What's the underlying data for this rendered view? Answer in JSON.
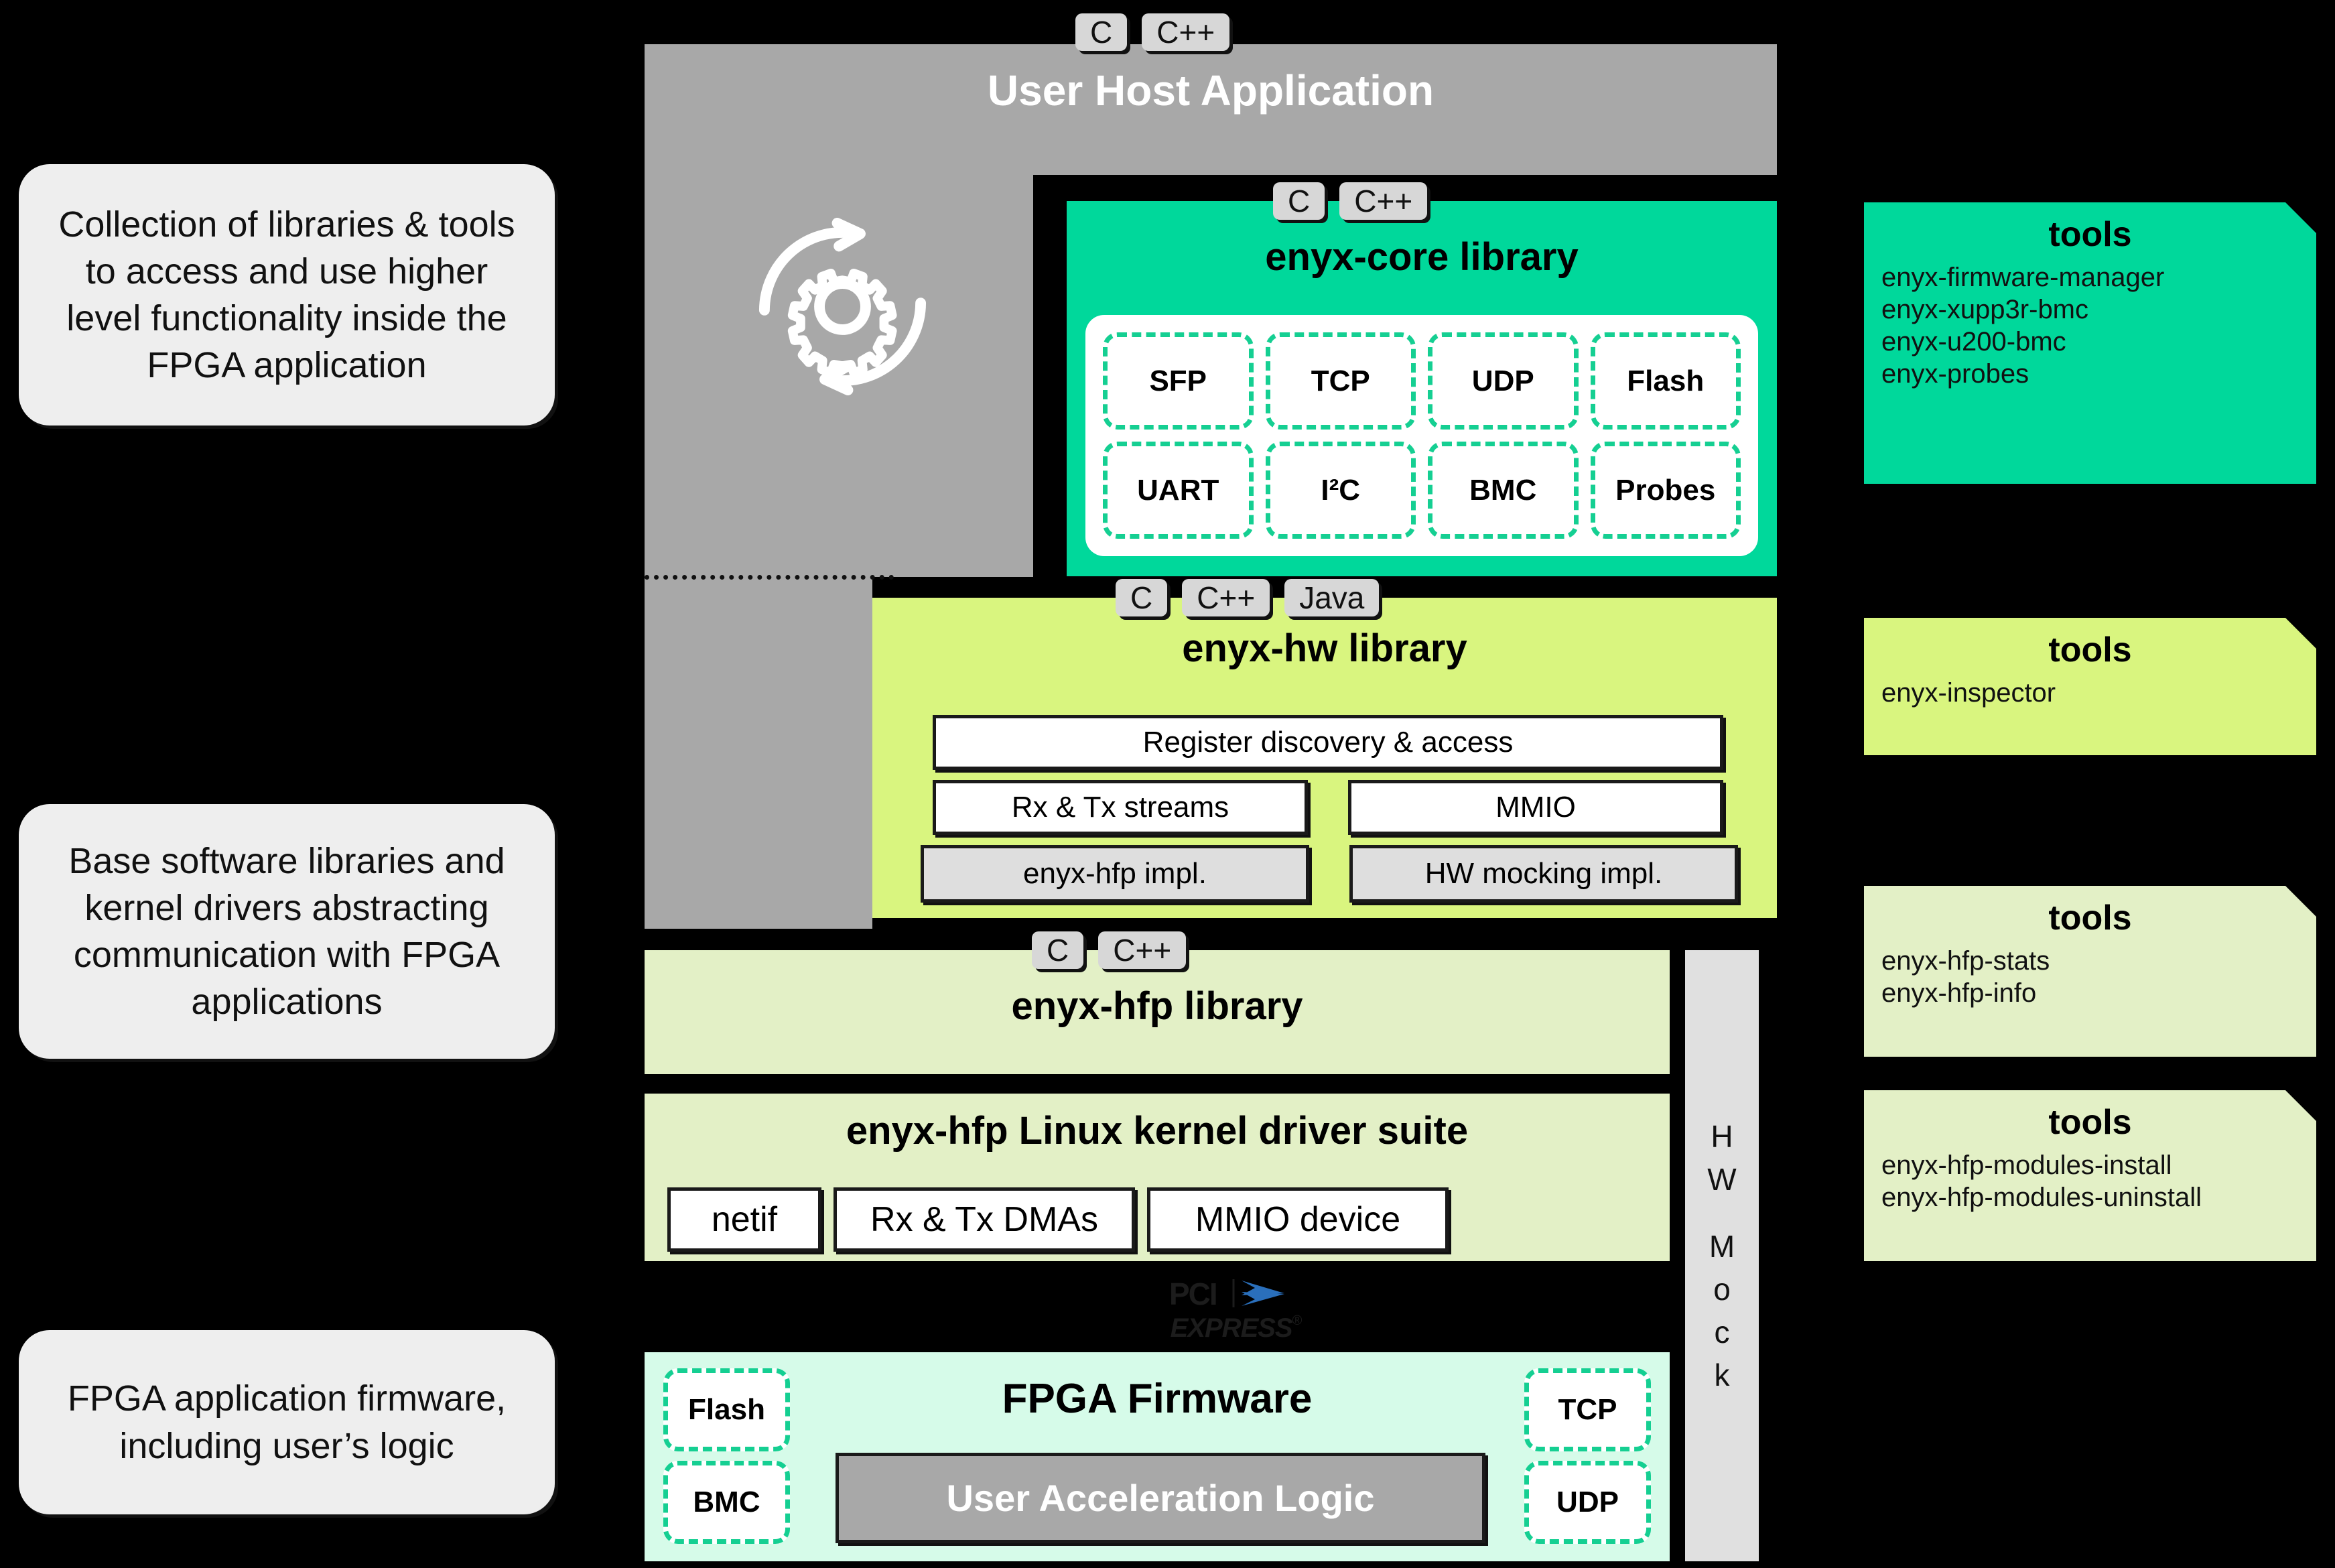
{
  "callouts": [
    {
      "text": "Collection of libraries & tools to access and use higher level functionality inside the FPGA application"
    },
    {
      "text": "Base software libraries and kernel drivers abstracting communication with FPGA applications"
    },
    {
      "text": "FPGA application firmware, including user’s logic"
    }
  ],
  "host": {
    "title": "User Host Application",
    "langs": [
      "C",
      "C++"
    ],
    "icon": "gear-sync-icon"
  },
  "core": {
    "title": "enyx-core library",
    "langs": [
      "C",
      "C++"
    ],
    "modules": [
      "SFP",
      "TCP",
      "UDP",
      "Flash",
      "UART",
      "I²C",
      "BMC",
      "Probes"
    ]
  },
  "hw": {
    "title": "enyx-hw library",
    "langs": [
      "C",
      "C++",
      "Java"
    ],
    "wide_item": "Register discovery & access",
    "row2": [
      "Rx & Tx streams",
      "MMIO"
    ],
    "row3": [
      "enyx-hfp impl.",
      "HW mocking impl."
    ]
  },
  "hfp_lib": {
    "title": "enyx-hfp library",
    "langs": [
      "C",
      "C++"
    ]
  },
  "kernel": {
    "title": "enyx-hfp Linux kernel driver suite",
    "items": [
      "netif",
      "Rx & Tx DMAs",
      "MMIO device"
    ]
  },
  "pcie": {
    "line1": "PCI",
    "line2": "EXPRESS",
    "mark": "®"
  },
  "firmware": {
    "title": "FPGA Firmware",
    "left_chips": [
      "Flash",
      "BMC"
    ],
    "right_chips": [
      "TCP",
      "UDP"
    ],
    "center": "User Acceleration Logic"
  },
  "hw_mock": {
    "letters": [
      "H",
      "W",
      "",
      "M",
      "o",
      "c",
      "k"
    ],
    "label": "HW Mock"
  },
  "tools": [
    {
      "title": "tools",
      "items": [
        "enyx-firmware-manager",
        "enyx-xupp3r-bmc",
        "enyx-u200-bmc",
        "enyx-probes"
      ],
      "theme": "green"
    },
    {
      "title": "tools",
      "items": [
        "enyx-inspector"
      ],
      "theme": "lime"
    },
    {
      "title": "tools",
      "items": [
        "enyx-hfp-stats",
        "enyx-hfp-info"
      ],
      "theme": "pale"
    },
    {
      "title": "tools",
      "items": [
        "enyx-hfp-modules-install",
        "enyx-hfp-modules-uninstall"
      ],
      "theme": "pale"
    }
  ],
  "colors": {
    "background": "#000000",
    "host_gray": "#a8a8a8",
    "core_green": "#00d89b",
    "hw_lime": "#d9f57f",
    "hfp_pale": "#e3f0c6",
    "fw_mint": "#d6fbe9",
    "chip_gray": "#d7d7d7",
    "pcie_blue": "#2a6fbb"
  }
}
